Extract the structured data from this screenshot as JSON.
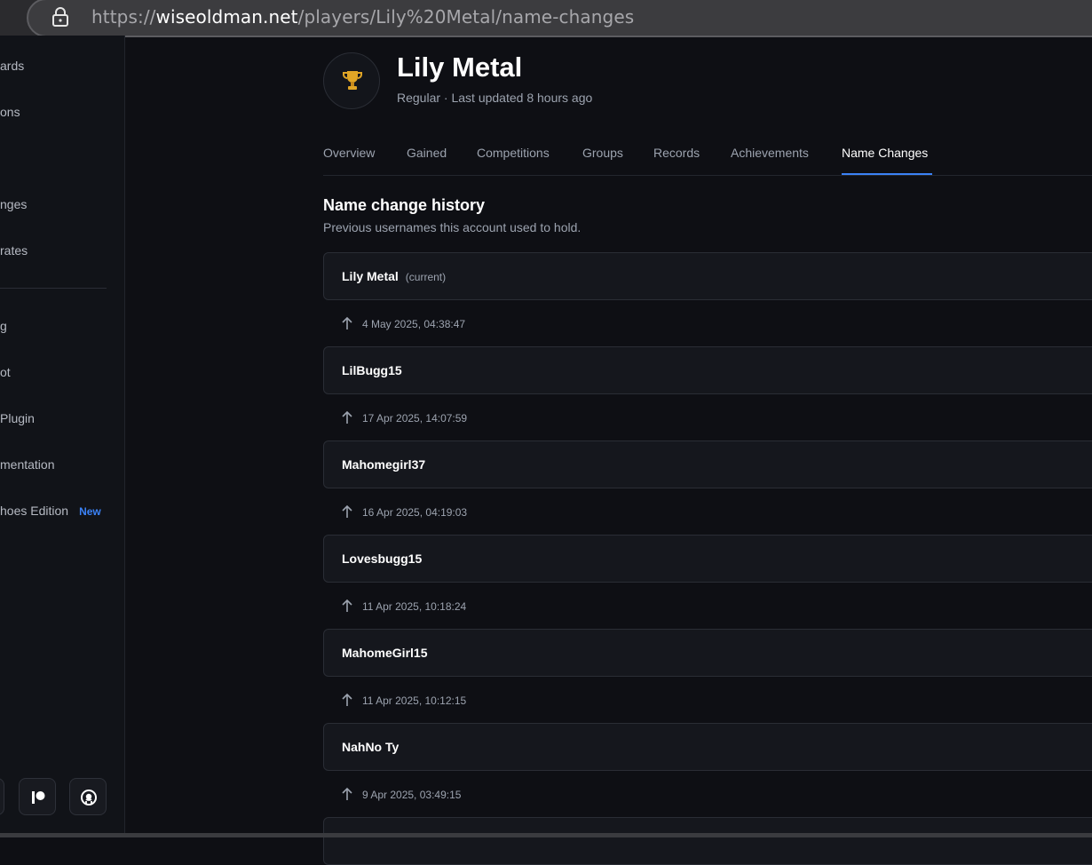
{
  "browser": {
    "url_prefix": "https://",
    "url_domain": "wiseoldman.net",
    "url_path": "/players/Lily%20Metal/name-changes",
    "lock_icon": "lock-icon"
  },
  "sidebar": {
    "items": [
      {
        "label": "ards",
        "badge": ""
      },
      {
        "label": "ons",
        "badge": ""
      },
      {
        "label": "nges",
        "badge": ""
      },
      {
        "label": " rates",
        "badge": ""
      },
      {
        "label": "g",
        "badge": ""
      },
      {
        "label": "ot",
        "badge": ""
      },
      {
        "label": "Plugin",
        "badge": ""
      },
      {
        "label": "mentation",
        "badge": ""
      },
      {
        "label": "hoes Edition",
        "badge": "New"
      }
    ],
    "icons": [
      "patreon-icon",
      "github-icon"
    ],
    "badge_color": "#3b82f6"
  },
  "player": {
    "name": "Lily Metal",
    "subtitle": "Regular · Last updated 8 hours ago",
    "avatar_icon": "trophy-icon"
  },
  "tabs": [
    {
      "label": "Overview",
      "active": false
    },
    {
      "label": "Gained",
      "active": false
    },
    {
      "label": "Competitions",
      "active": false
    },
    {
      "label": "Groups",
      "active": false
    },
    {
      "label": "Records",
      "active": false
    },
    {
      "label": "Achievements",
      "active": false
    },
    {
      "label": "Name Changes",
      "active": true
    }
  ],
  "history": {
    "title": "Name change history",
    "subtitle": "Previous usernames this account used to hold.",
    "entries": [
      {
        "name": "Lily Metal",
        "tag": "(current)",
        "date": "4 May 2025, 04:38:47"
      },
      {
        "name": "LilBugg15",
        "tag": "",
        "date": "17 Apr 2025, 14:07:59"
      },
      {
        "name": "Mahomegirl37",
        "tag": "",
        "date": "16 Apr 2025, 04:19:03"
      },
      {
        "name": "Lovesbugg15",
        "tag": "",
        "date": "11 Apr 2025, 10:18:24"
      },
      {
        "name": "MahomeGirl15",
        "tag": "",
        "date": "11 Apr 2025, 10:12:15"
      },
      {
        "name": "NahNo Ty",
        "tag": "",
        "date": "9 Apr 2025, 03:49:15"
      }
    ]
  },
  "colors": {
    "accent": "#3b82f6",
    "background": "#0e0f14",
    "card": "#15171d"
  }
}
